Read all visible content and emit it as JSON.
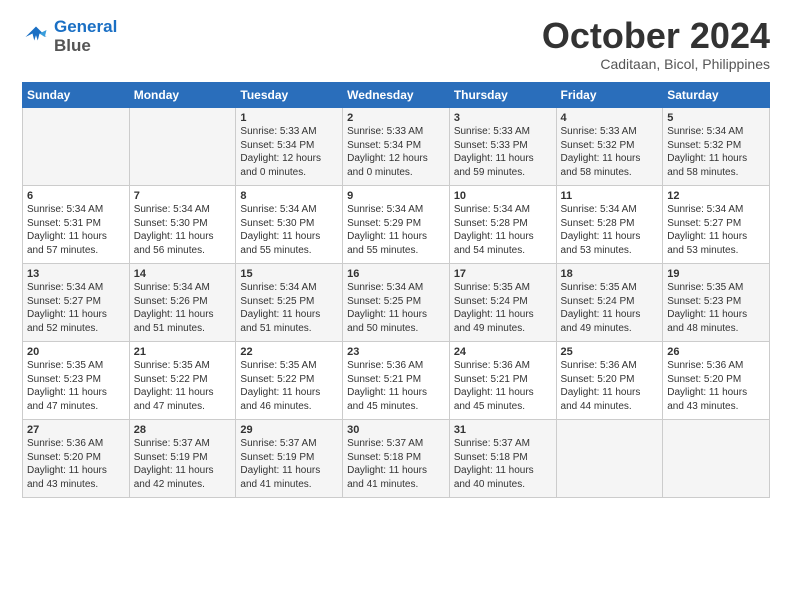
{
  "logo": {
    "line1": "General",
    "line2": "Blue"
  },
  "title": "October 2024",
  "location": "Caditaan, Bicol, Philippines",
  "weekdays": [
    "Sunday",
    "Monday",
    "Tuesday",
    "Wednesday",
    "Thursday",
    "Friday",
    "Saturday"
  ],
  "weeks": [
    [
      {
        "day": "",
        "content": ""
      },
      {
        "day": "",
        "content": ""
      },
      {
        "day": "1",
        "content": "Sunrise: 5:33 AM\nSunset: 5:34 PM\nDaylight: 12 hours\nand 0 minutes."
      },
      {
        "day": "2",
        "content": "Sunrise: 5:33 AM\nSunset: 5:34 PM\nDaylight: 12 hours\nand 0 minutes."
      },
      {
        "day": "3",
        "content": "Sunrise: 5:33 AM\nSunset: 5:33 PM\nDaylight: 11 hours\nand 59 minutes."
      },
      {
        "day": "4",
        "content": "Sunrise: 5:33 AM\nSunset: 5:32 PM\nDaylight: 11 hours\nand 58 minutes."
      },
      {
        "day": "5",
        "content": "Sunrise: 5:34 AM\nSunset: 5:32 PM\nDaylight: 11 hours\nand 58 minutes."
      }
    ],
    [
      {
        "day": "6",
        "content": "Sunrise: 5:34 AM\nSunset: 5:31 PM\nDaylight: 11 hours\nand 57 minutes."
      },
      {
        "day": "7",
        "content": "Sunrise: 5:34 AM\nSunset: 5:30 PM\nDaylight: 11 hours\nand 56 minutes."
      },
      {
        "day": "8",
        "content": "Sunrise: 5:34 AM\nSunset: 5:30 PM\nDaylight: 11 hours\nand 55 minutes."
      },
      {
        "day": "9",
        "content": "Sunrise: 5:34 AM\nSunset: 5:29 PM\nDaylight: 11 hours\nand 55 minutes."
      },
      {
        "day": "10",
        "content": "Sunrise: 5:34 AM\nSunset: 5:28 PM\nDaylight: 11 hours\nand 54 minutes."
      },
      {
        "day": "11",
        "content": "Sunrise: 5:34 AM\nSunset: 5:28 PM\nDaylight: 11 hours\nand 53 minutes."
      },
      {
        "day": "12",
        "content": "Sunrise: 5:34 AM\nSunset: 5:27 PM\nDaylight: 11 hours\nand 53 minutes."
      }
    ],
    [
      {
        "day": "13",
        "content": "Sunrise: 5:34 AM\nSunset: 5:27 PM\nDaylight: 11 hours\nand 52 minutes."
      },
      {
        "day": "14",
        "content": "Sunrise: 5:34 AM\nSunset: 5:26 PM\nDaylight: 11 hours\nand 51 minutes."
      },
      {
        "day": "15",
        "content": "Sunrise: 5:34 AM\nSunset: 5:25 PM\nDaylight: 11 hours\nand 51 minutes."
      },
      {
        "day": "16",
        "content": "Sunrise: 5:34 AM\nSunset: 5:25 PM\nDaylight: 11 hours\nand 50 minutes."
      },
      {
        "day": "17",
        "content": "Sunrise: 5:35 AM\nSunset: 5:24 PM\nDaylight: 11 hours\nand 49 minutes."
      },
      {
        "day": "18",
        "content": "Sunrise: 5:35 AM\nSunset: 5:24 PM\nDaylight: 11 hours\nand 49 minutes."
      },
      {
        "day": "19",
        "content": "Sunrise: 5:35 AM\nSunset: 5:23 PM\nDaylight: 11 hours\nand 48 minutes."
      }
    ],
    [
      {
        "day": "20",
        "content": "Sunrise: 5:35 AM\nSunset: 5:23 PM\nDaylight: 11 hours\nand 47 minutes."
      },
      {
        "day": "21",
        "content": "Sunrise: 5:35 AM\nSunset: 5:22 PM\nDaylight: 11 hours\nand 47 minutes."
      },
      {
        "day": "22",
        "content": "Sunrise: 5:35 AM\nSunset: 5:22 PM\nDaylight: 11 hours\nand 46 minutes."
      },
      {
        "day": "23",
        "content": "Sunrise: 5:36 AM\nSunset: 5:21 PM\nDaylight: 11 hours\nand 45 minutes."
      },
      {
        "day": "24",
        "content": "Sunrise: 5:36 AM\nSunset: 5:21 PM\nDaylight: 11 hours\nand 45 minutes."
      },
      {
        "day": "25",
        "content": "Sunrise: 5:36 AM\nSunset: 5:20 PM\nDaylight: 11 hours\nand 44 minutes."
      },
      {
        "day": "26",
        "content": "Sunrise: 5:36 AM\nSunset: 5:20 PM\nDaylight: 11 hours\nand 43 minutes."
      }
    ],
    [
      {
        "day": "27",
        "content": "Sunrise: 5:36 AM\nSunset: 5:20 PM\nDaylight: 11 hours\nand 43 minutes."
      },
      {
        "day": "28",
        "content": "Sunrise: 5:37 AM\nSunset: 5:19 PM\nDaylight: 11 hours\nand 42 minutes."
      },
      {
        "day": "29",
        "content": "Sunrise: 5:37 AM\nSunset: 5:19 PM\nDaylight: 11 hours\nand 41 minutes."
      },
      {
        "day": "30",
        "content": "Sunrise: 5:37 AM\nSunset: 5:18 PM\nDaylight: 11 hours\nand 41 minutes."
      },
      {
        "day": "31",
        "content": "Sunrise: 5:37 AM\nSunset: 5:18 PM\nDaylight: 11 hours\nand 40 minutes."
      },
      {
        "day": "",
        "content": ""
      },
      {
        "day": "",
        "content": ""
      }
    ]
  ]
}
